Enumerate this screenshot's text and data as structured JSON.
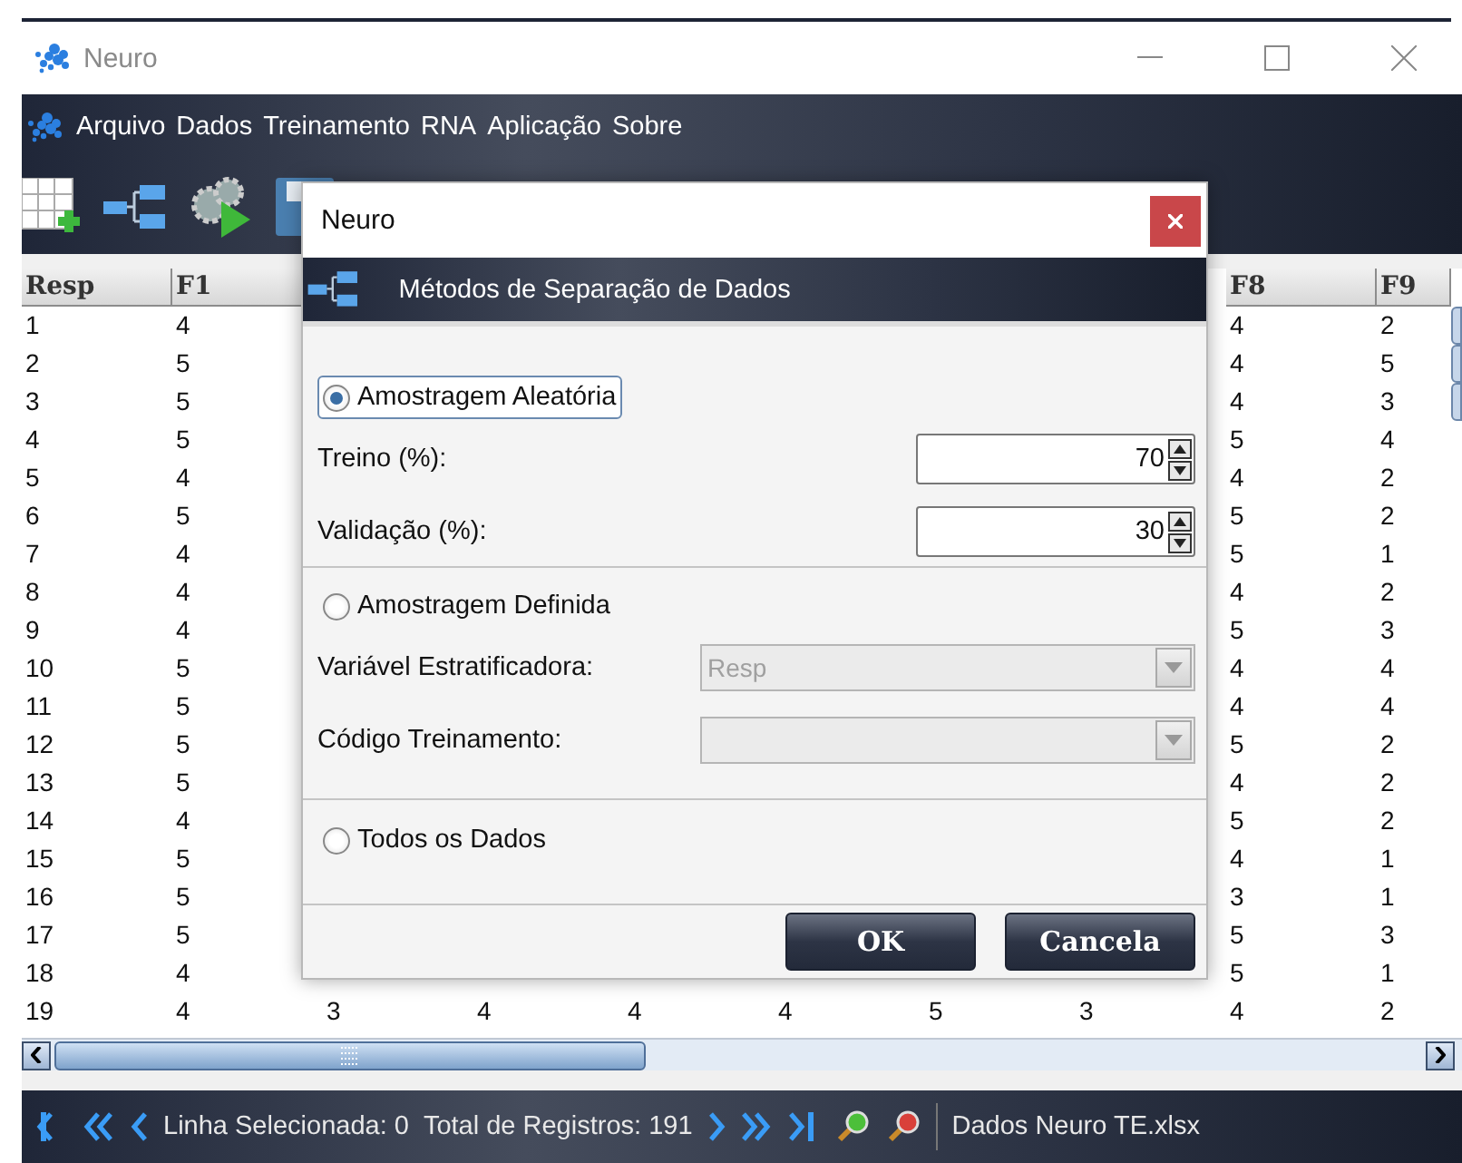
{
  "window": {
    "title": "Neuro"
  },
  "menu": [
    "Arquivo",
    "Dados",
    "Treinamento",
    "RNA",
    "Aplicação",
    "Sobre"
  ],
  "table": {
    "columns": [
      "Resp",
      "F1",
      null,
      null,
      null,
      null,
      null,
      null,
      "F8",
      "F9"
    ],
    "rows": [
      {
        "cells": [
          "1",
          "4",
          null,
          null,
          null,
          null,
          null,
          null,
          "4",
          "2"
        ]
      },
      {
        "cells": [
          "2",
          "5",
          null,
          null,
          null,
          null,
          null,
          null,
          "4",
          "5"
        ]
      },
      {
        "cells": [
          "3",
          "5",
          null,
          null,
          null,
          null,
          null,
          null,
          "4",
          "3"
        ]
      },
      {
        "cells": [
          "4",
          "5",
          null,
          null,
          null,
          null,
          null,
          null,
          "5",
          "4"
        ]
      },
      {
        "cells": [
          "5",
          "4",
          null,
          null,
          null,
          null,
          null,
          null,
          "4",
          "2"
        ]
      },
      {
        "cells": [
          "6",
          "5",
          null,
          null,
          null,
          null,
          null,
          null,
          "5",
          "2"
        ]
      },
      {
        "cells": [
          "7",
          "4",
          null,
          null,
          null,
          null,
          null,
          null,
          "5",
          "1"
        ]
      },
      {
        "cells": [
          "8",
          "4",
          null,
          null,
          null,
          null,
          null,
          null,
          "4",
          "2"
        ]
      },
      {
        "cells": [
          "9",
          "4",
          null,
          null,
          null,
          null,
          null,
          null,
          "5",
          "3"
        ]
      },
      {
        "cells": [
          "10",
          "5",
          null,
          null,
          null,
          null,
          null,
          null,
          "4",
          "4"
        ]
      },
      {
        "cells": [
          "11",
          "5",
          null,
          null,
          null,
          null,
          null,
          null,
          "4",
          "4"
        ]
      },
      {
        "cells": [
          "12",
          "5",
          null,
          null,
          null,
          null,
          null,
          null,
          "5",
          "2"
        ]
      },
      {
        "cells": [
          "13",
          "5",
          null,
          null,
          null,
          null,
          null,
          null,
          "4",
          "2"
        ]
      },
      {
        "cells": [
          "14",
          "4",
          null,
          null,
          null,
          null,
          null,
          null,
          "5",
          "2"
        ]
      },
      {
        "cells": [
          "15",
          "5",
          null,
          null,
          null,
          null,
          null,
          null,
          "4",
          "1"
        ]
      },
      {
        "cells": [
          "16",
          "5",
          null,
          null,
          null,
          null,
          null,
          null,
          "3",
          "1"
        ]
      },
      {
        "cells": [
          "17",
          "5",
          null,
          null,
          null,
          null,
          null,
          null,
          "5",
          "3"
        ]
      },
      {
        "cells": [
          "18",
          "4",
          null,
          null,
          null,
          null,
          null,
          null,
          "5",
          "1"
        ]
      },
      {
        "cells": [
          "19",
          "4",
          "3",
          "4",
          "4",
          "4",
          "5",
          "3",
          "4",
          "2"
        ]
      }
    ]
  },
  "dialog": {
    "title": "Neuro",
    "header": "Métodos de Separação de Dados",
    "options": [
      {
        "label": "Amostragem Aleatória",
        "selected": true,
        "fields": [
          {
            "kind": "spinner",
            "label": "Treino (%):",
            "value": "70",
            "disabled": false
          },
          {
            "kind": "spinner",
            "label": "Validação (%):",
            "value": "30",
            "disabled": false
          }
        ]
      },
      {
        "label": "Amostragem Definida",
        "selected": false,
        "fields": [
          {
            "kind": "select",
            "label": "Variável Estratificadora:",
            "value": "Resp",
            "disabled": true
          },
          {
            "kind": "select",
            "label": "Código Treinamento:",
            "disabled": true
          }
        ]
      },
      {
        "label": "Todos os Dados",
        "selected": false
      }
    ],
    "buttons": [
      "OK",
      "Cancela"
    ]
  },
  "status_bar": {
    "selected_row": "Linha Selecionada: 0",
    "total": "Total de Registros: 191",
    "file": "Dados Neuro TE.xlsx"
  }
}
